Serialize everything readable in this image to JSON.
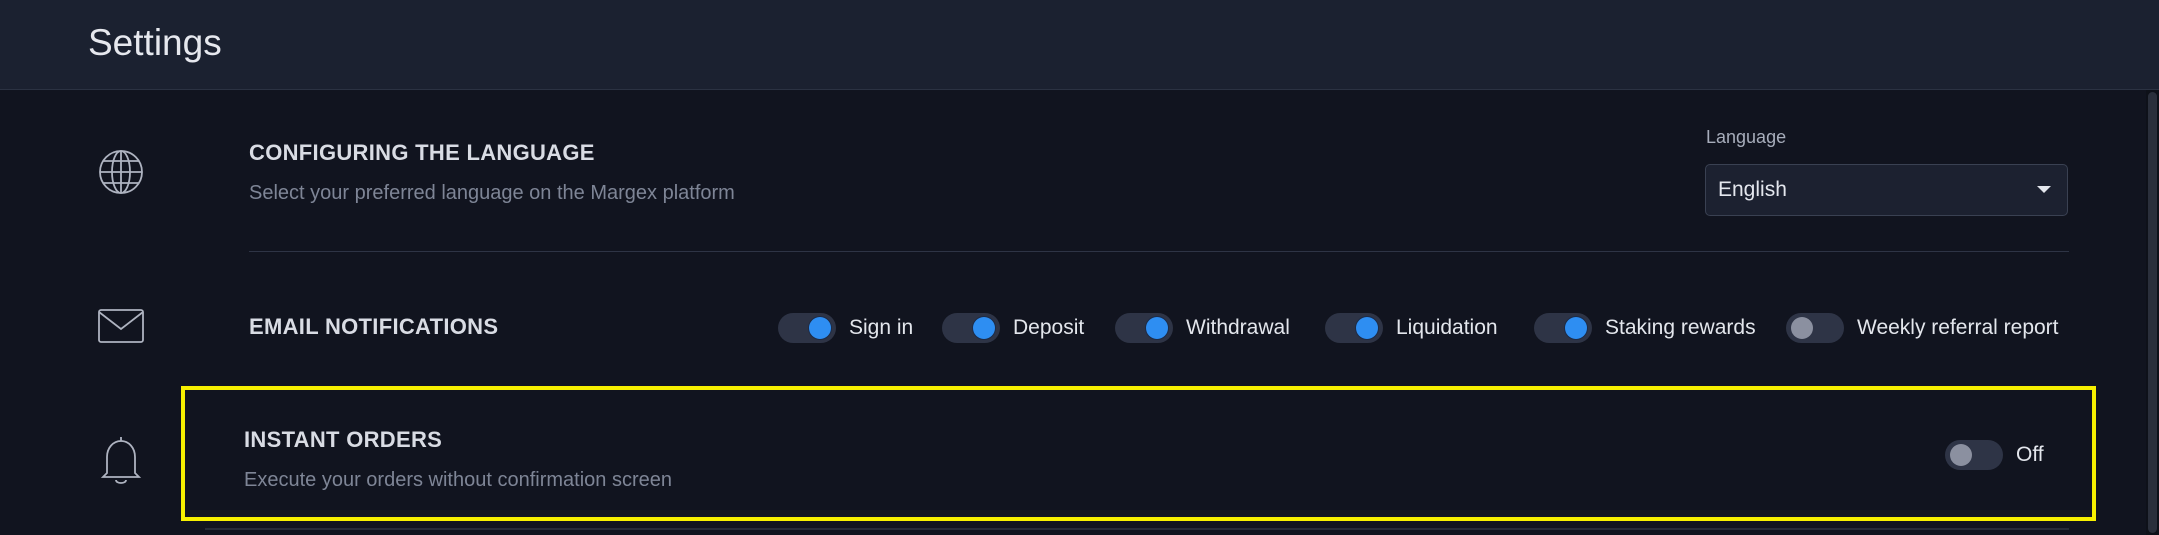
{
  "header": {
    "title": "Settings"
  },
  "language_section": {
    "title": "CONFIGURING THE LANGUAGE",
    "description": "Select your preferred language on the Margex platform",
    "select_label": "Language",
    "select_value": "English",
    "icon": "globe-icon"
  },
  "email_section": {
    "title": "EMAIL NOTIFICATIONS",
    "icon": "envelope-icon",
    "toggles": [
      {
        "label": "Sign in",
        "on": true
      },
      {
        "label": "Deposit",
        "on": true
      },
      {
        "label": "Withdrawal",
        "on": true
      },
      {
        "label": "Liquidation",
        "on": true
      },
      {
        "label": "Staking rewards",
        "on": true
      },
      {
        "label": "Weekly referral report",
        "on": false
      }
    ]
  },
  "instant_section": {
    "title": "INSTANT ORDERS",
    "description": "Execute your orders without confirmation screen",
    "icon": "bell-icon",
    "toggle_label": "Off",
    "toggle_on": false
  },
  "colors": {
    "background": "#11141f",
    "header": "#1b2130",
    "accent": "#2e8ef2",
    "highlight": "#f7f000"
  }
}
